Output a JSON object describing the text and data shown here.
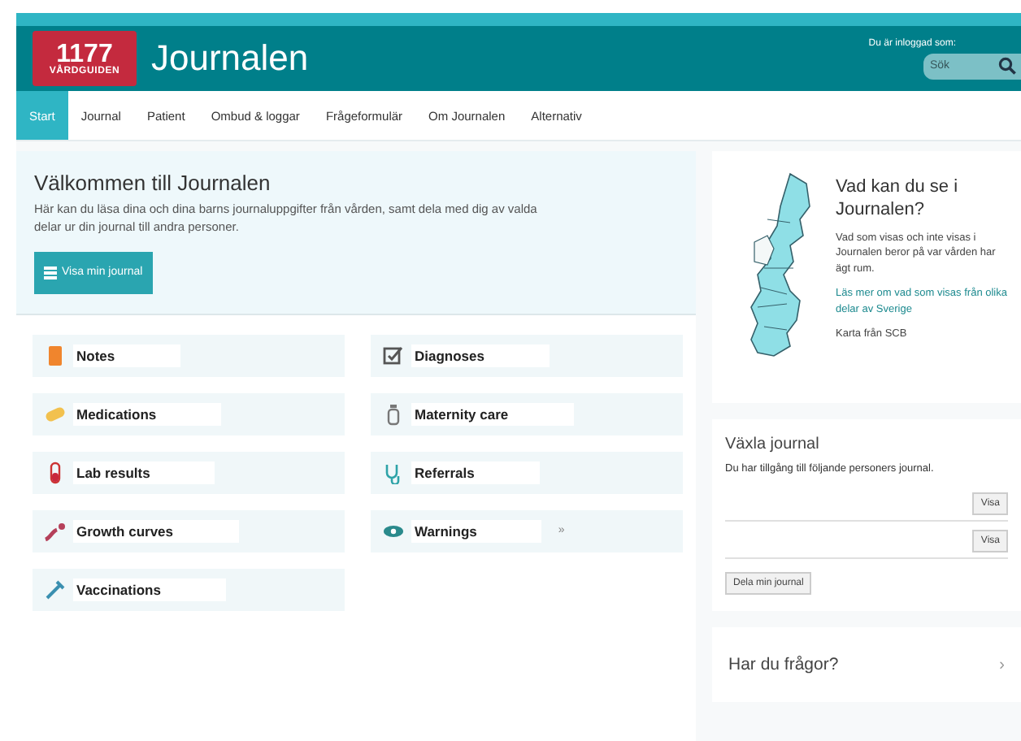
{
  "header": {
    "logo": {
      "number": "1177",
      "name": "VÅRDGUIDEN"
    },
    "title": "Journalen",
    "login_label": "Du är inloggad som:",
    "search": {
      "placeholder": "Sök"
    }
  },
  "nav": [
    {
      "label": "Start",
      "selected": true
    },
    {
      "label": "Journal",
      "selected": false
    },
    {
      "label": "Patient",
      "selected": false
    },
    {
      "label": "Ombud & loggar",
      "selected": false
    },
    {
      "label": "Frågeformulär",
      "selected": false
    },
    {
      "label": "Om Journalen",
      "selected": false
    },
    {
      "label": "Alternativ",
      "selected": false
    }
  ],
  "welcome": {
    "title": "Välkommen till Journalen",
    "text": "Här kan du läsa dina och dina barns journaluppgifter från vården, samt dela med dig av valda delar ur din journal till andra personer.",
    "button": "Visa min journal"
  },
  "categories": [
    {
      "label": "Notes"
    },
    {
      "label": "Diagnoses"
    },
    {
      "label": "Medications"
    },
    {
      "label": "Maternity care"
    },
    {
      "label": "Lab results"
    },
    {
      "label": "Referrals"
    },
    {
      "label": "Growth curves"
    },
    {
      "label": "Warnings",
      "chevron": "»"
    },
    {
      "label": "Vaccinations"
    }
  ],
  "info_card": {
    "title": "Vad kan du se i Journalen?",
    "text": "Vad som visas och inte visas i Journalen beror på var vården har ägt rum.",
    "link": "Läs mer om vad som visas från olika delar av Sverige",
    "caption": "Karta från SCB"
  },
  "switch_card": {
    "title": "Växla journal",
    "text": "Du har tillgång till följande personers journal.",
    "rows": [
      {
        "button": "Visa"
      },
      {
        "button": "Visa"
      }
    ],
    "share_button": "Dela min journal"
  },
  "questions_card": {
    "title": "Har du frågor?",
    "chevron": "›"
  }
}
